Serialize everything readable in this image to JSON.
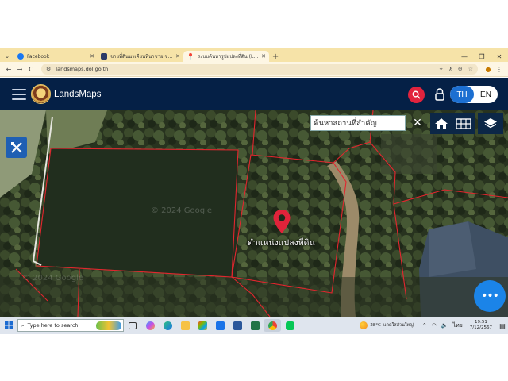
{
  "browser": {
    "tabs": [
      {
        "title": "Facebook",
        "favicon_color": "#1877f2",
        "active": false
      },
      {
        "title": "ขายที่ดินนาเคียนที่นาชาย ขายที่ดินนี้ใ",
        "favicon_color": "#2b3a67",
        "active": false
      },
      {
        "title": "ระบบค้นหารูปแปลงที่ดิน (LandsMaps)",
        "favicon_color": "#e2233d",
        "active": true
      }
    ],
    "close_glyph": "✕",
    "new_tab_glyph": "+",
    "window_controls": {
      "minimize": "—",
      "restore": "❐",
      "close": "✕"
    },
    "nav": {
      "back": "←",
      "forward": "→",
      "reload": "C"
    },
    "url": "landsmaps.dol.go.th"
  },
  "app": {
    "brand": "LandsMaps",
    "lang_th": "TH",
    "lang_en": "EN",
    "accent_color": "#e2233d",
    "header_color": "#052046"
  },
  "map": {
    "search_placeholder": "ค้นหาสถานที่สำคัญ",
    "clear_label": "✕",
    "parcel_label": "ตำแหน่งแปลงที่ดิน",
    "watermark": "© 2024 Google",
    "fab_label": "•••"
  },
  "taskbar": {
    "search_placeholder": "Type here to search",
    "weather_temp": "28°C",
    "weather_text": "แดดใสส่วนใหญ่",
    "lang": "ไทย",
    "time": "19:51",
    "date": "7/12/2567"
  }
}
